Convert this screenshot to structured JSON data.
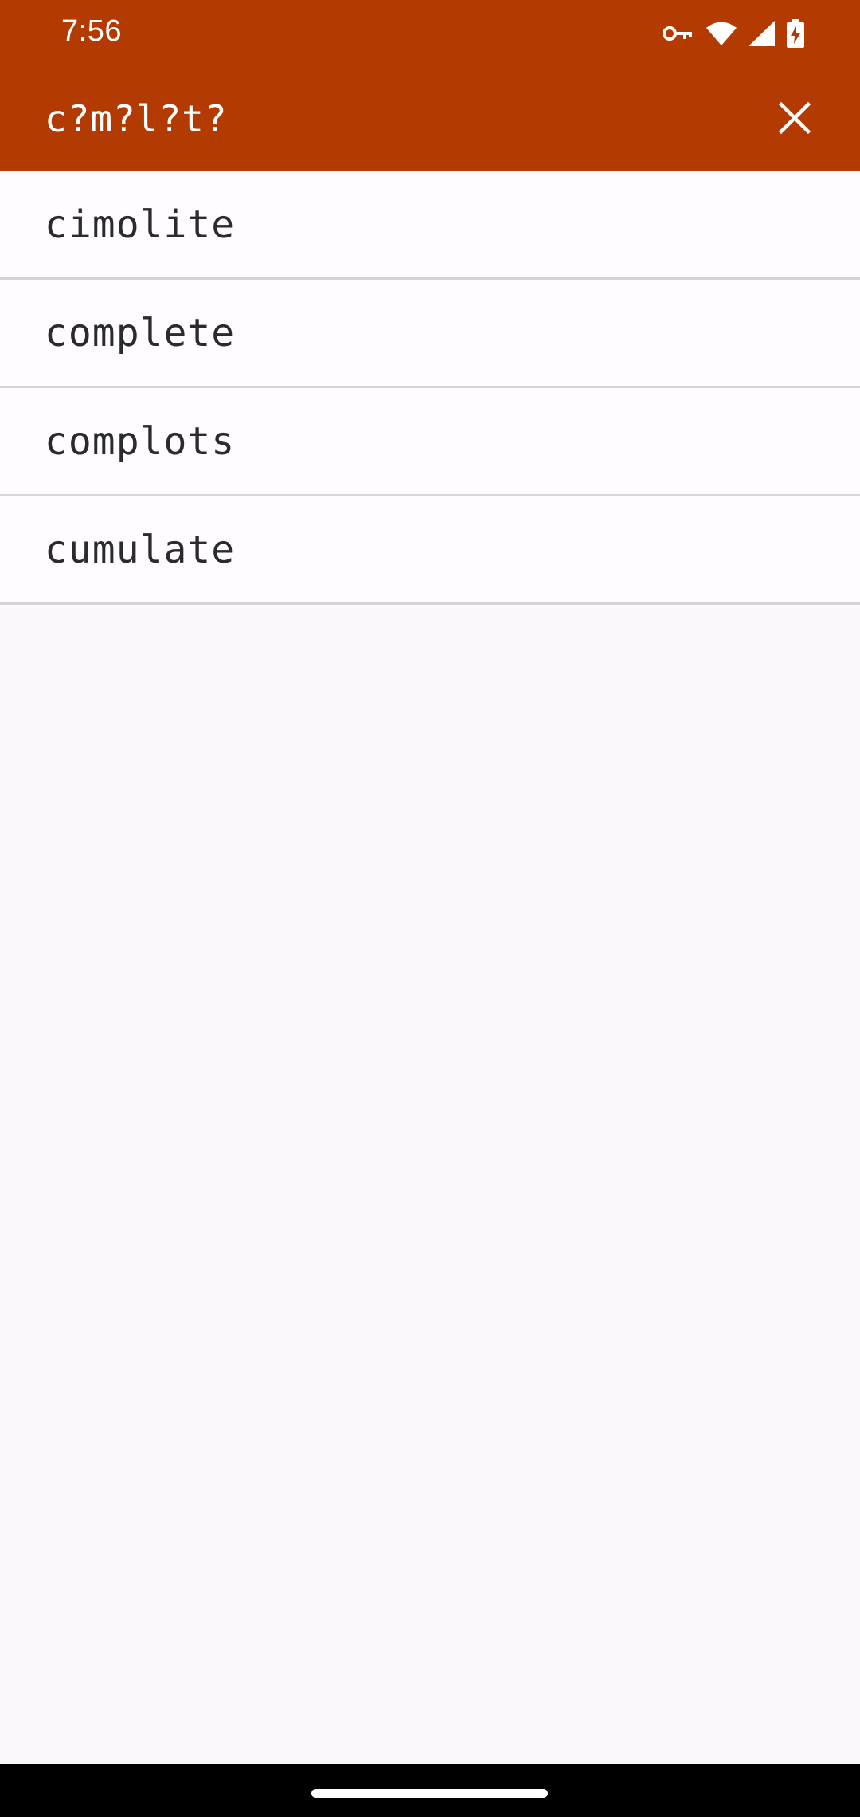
{
  "status_bar": {
    "time": "7:56",
    "icons": [
      "vpn-key-icon",
      "wifi-icon",
      "cell-signal-icon",
      "battery-charging-icon"
    ]
  },
  "app_bar": {
    "query": "c?m?l?t?",
    "close_icon": "close-icon"
  },
  "results": [
    {
      "word": "cimolite"
    },
    {
      "word": "complete"
    },
    {
      "word": "complots"
    },
    {
      "word": "cumulate"
    }
  ],
  "colors": {
    "accent": "#b33a00",
    "background": "#fcf6fd",
    "divider": "#d6d3d6",
    "text": "#2b2a2d"
  }
}
